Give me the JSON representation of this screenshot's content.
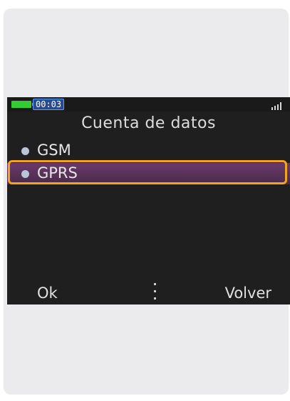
{
  "status_bar": {
    "clock": "00:03",
    "battery_color": "#33cc33",
    "signal_icon": "signal-bars-icon"
  },
  "screen": {
    "title": "Cuenta de datos",
    "items": [
      {
        "label": "GSM",
        "selected": false
      },
      {
        "label": "GPRS",
        "selected": true
      }
    ],
    "softkeys": {
      "left": "Ok",
      "right": "Volver"
    }
  },
  "colors": {
    "card_background": "#ebebed",
    "screen_background": "#1f1f1f",
    "selection": "#5a3060",
    "highlight_border": "#f2a51c"
  }
}
